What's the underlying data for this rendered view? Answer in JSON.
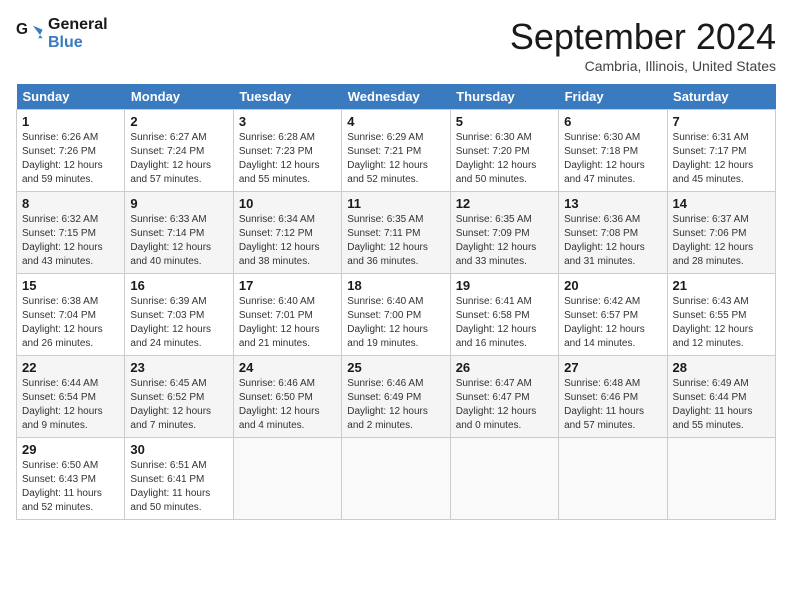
{
  "header": {
    "logo_line1": "General",
    "logo_line2": "Blue",
    "month": "September 2024",
    "location": "Cambria, Illinois, United States"
  },
  "weekdays": [
    "Sunday",
    "Monday",
    "Tuesday",
    "Wednesday",
    "Thursday",
    "Friday",
    "Saturday"
  ],
  "weeks": [
    [
      {
        "day": "1",
        "info": "Sunrise: 6:26 AM\nSunset: 7:26 PM\nDaylight: 12 hours\nand 59 minutes."
      },
      {
        "day": "2",
        "info": "Sunrise: 6:27 AM\nSunset: 7:24 PM\nDaylight: 12 hours\nand 57 minutes."
      },
      {
        "day": "3",
        "info": "Sunrise: 6:28 AM\nSunset: 7:23 PM\nDaylight: 12 hours\nand 55 minutes."
      },
      {
        "day": "4",
        "info": "Sunrise: 6:29 AM\nSunset: 7:21 PM\nDaylight: 12 hours\nand 52 minutes."
      },
      {
        "day": "5",
        "info": "Sunrise: 6:30 AM\nSunset: 7:20 PM\nDaylight: 12 hours\nand 50 minutes."
      },
      {
        "day": "6",
        "info": "Sunrise: 6:30 AM\nSunset: 7:18 PM\nDaylight: 12 hours\nand 47 minutes."
      },
      {
        "day": "7",
        "info": "Sunrise: 6:31 AM\nSunset: 7:17 PM\nDaylight: 12 hours\nand 45 minutes."
      }
    ],
    [
      {
        "day": "8",
        "info": "Sunrise: 6:32 AM\nSunset: 7:15 PM\nDaylight: 12 hours\nand 43 minutes."
      },
      {
        "day": "9",
        "info": "Sunrise: 6:33 AM\nSunset: 7:14 PM\nDaylight: 12 hours\nand 40 minutes."
      },
      {
        "day": "10",
        "info": "Sunrise: 6:34 AM\nSunset: 7:12 PM\nDaylight: 12 hours\nand 38 minutes."
      },
      {
        "day": "11",
        "info": "Sunrise: 6:35 AM\nSunset: 7:11 PM\nDaylight: 12 hours\nand 36 minutes."
      },
      {
        "day": "12",
        "info": "Sunrise: 6:35 AM\nSunset: 7:09 PM\nDaylight: 12 hours\nand 33 minutes."
      },
      {
        "day": "13",
        "info": "Sunrise: 6:36 AM\nSunset: 7:08 PM\nDaylight: 12 hours\nand 31 minutes."
      },
      {
        "day": "14",
        "info": "Sunrise: 6:37 AM\nSunset: 7:06 PM\nDaylight: 12 hours\nand 28 minutes."
      }
    ],
    [
      {
        "day": "15",
        "info": "Sunrise: 6:38 AM\nSunset: 7:04 PM\nDaylight: 12 hours\nand 26 minutes."
      },
      {
        "day": "16",
        "info": "Sunrise: 6:39 AM\nSunset: 7:03 PM\nDaylight: 12 hours\nand 24 minutes."
      },
      {
        "day": "17",
        "info": "Sunrise: 6:40 AM\nSunset: 7:01 PM\nDaylight: 12 hours\nand 21 minutes."
      },
      {
        "day": "18",
        "info": "Sunrise: 6:40 AM\nSunset: 7:00 PM\nDaylight: 12 hours\nand 19 minutes."
      },
      {
        "day": "19",
        "info": "Sunrise: 6:41 AM\nSunset: 6:58 PM\nDaylight: 12 hours\nand 16 minutes."
      },
      {
        "day": "20",
        "info": "Sunrise: 6:42 AM\nSunset: 6:57 PM\nDaylight: 12 hours\nand 14 minutes."
      },
      {
        "day": "21",
        "info": "Sunrise: 6:43 AM\nSunset: 6:55 PM\nDaylight: 12 hours\nand 12 minutes."
      }
    ],
    [
      {
        "day": "22",
        "info": "Sunrise: 6:44 AM\nSunset: 6:54 PM\nDaylight: 12 hours\nand 9 minutes."
      },
      {
        "day": "23",
        "info": "Sunrise: 6:45 AM\nSunset: 6:52 PM\nDaylight: 12 hours\nand 7 minutes."
      },
      {
        "day": "24",
        "info": "Sunrise: 6:46 AM\nSunset: 6:50 PM\nDaylight: 12 hours\nand 4 minutes."
      },
      {
        "day": "25",
        "info": "Sunrise: 6:46 AM\nSunset: 6:49 PM\nDaylight: 12 hours\nand 2 minutes."
      },
      {
        "day": "26",
        "info": "Sunrise: 6:47 AM\nSunset: 6:47 PM\nDaylight: 12 hours\nand 0 minutes."
      },
      {
        "day": "27",
        "info": "Sunrise: 6:48 AM\nSunset: 6:46 PM\nDaylight: 11 hours\nand 57 minutes."
      },
      {
        "day": "28",
        "info": "Sunrise: 6:49 AM\nSunset: 6:44 PM\nDaylight: 11 hours\nand 55 minutes."
      }
    ],
    [
      {
        "day": "29",
        "info": "Sunrise: 6:50 AM\nSunset: 6:43 PM\nDaylight: 11 hours\nand 52 minutes."
      },
      {
        "day": "30",
        "info": "Sunrise: 6:51 AM\nSunset: 6:41 PM\nDaylight: 11 hours\nand 50 minutes."
      },
      {
        "day": "",
        "info": ""
      },
      {
        "day": "",
        "info": ""
      },
      {
        "day": "",
        "info": ""
      },
      {
        "day": "",
        "info": ""
      },
      {
        "day": "",
        "info": ""
      }
    ]
  ]
}
